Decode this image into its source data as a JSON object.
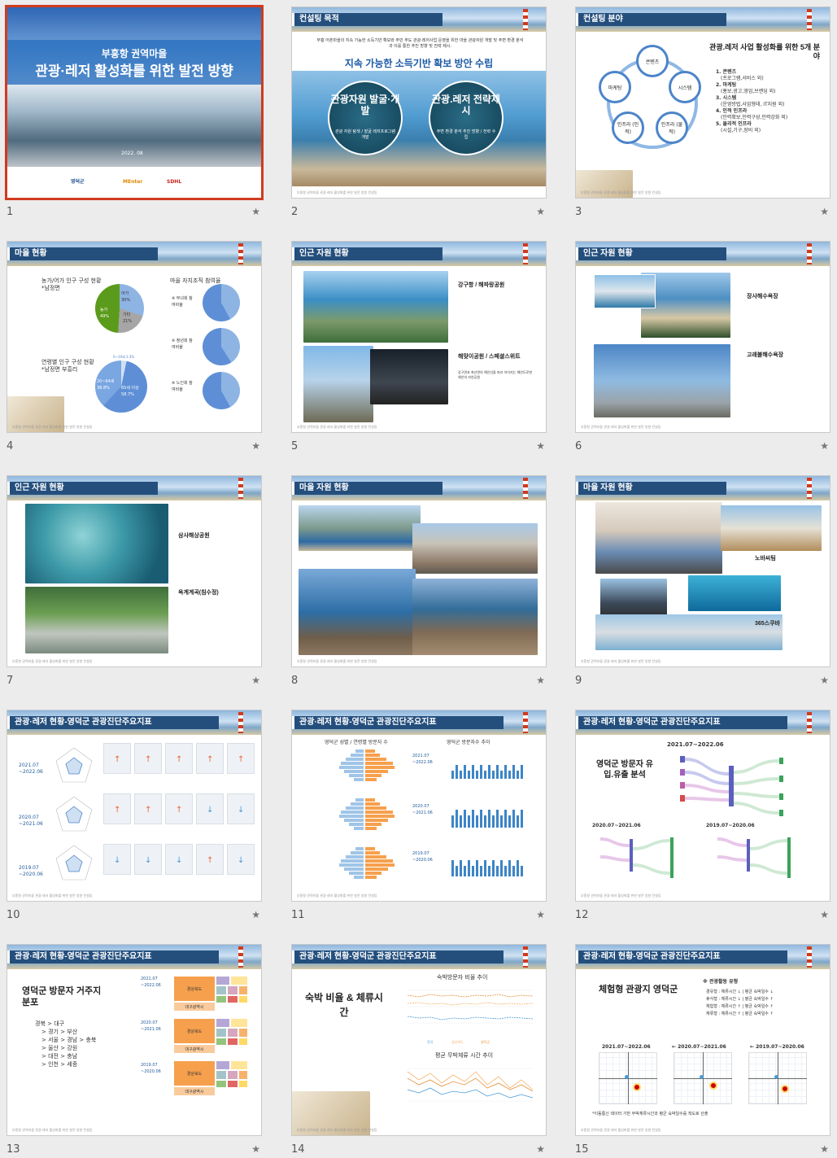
{
  "slides": [
    {
      "num": "1",
      "title_line1": "부흥항 권역마을",
      "title_line2": "관광·레저 활성화를 위한 발전 방향",
      "date": "2022. 08",
      "logo1": "영덕군",
      "logo2": "MEnter",
      "logo3": "SDHL"
    },
    {
      "num": "2",
      "header": "컨설팅 목적",
      "intro": "부흥 어촌마을의 지속 가능한 소득기반 확보와 주민 주도 관광·레저사업 운영을 위한 마을 관광자원 개발 및 주변 환경 분석과 이를 통한 추진 방향 및 전략 제시.",
      "headline": "지속 가능한 소득기반 확보 방안 수립",
      "circle1_title": "관광자원 발굴·개발",
      "circle1_sub": "관광 자원 탐색 / 발굴 레저프로그램 개발",
      "circle2_title": "관광.레저 전략제시",
      "circle2_sub": "주변 환경 분석 추진 방향 / 전략 수립"
    },
    {
      "num": "3",
      "header": "컨설팅 분야",
      "title": "관광.레저 사업 활성화를 위한 5개 분야",
      "nodes": [
        "콘텐츠",
        "시스템",
        "인프라 (물적)",
        "인프라 (인적)",
        "마케팅"
      ],
      "items": [
        {
          "t": "1. 콘텐츠",
          "d": "(프로그램,서비스 외)"
        },
        {
          "t": "2. 마케팅",
          "d": "(홍보,광고,영업,브랜딩 외)"
        },
        {
          "t": "3. 시스템",
          "d": "(운영방법,사업형태, IT지원 외)"
        },
        {
          "t": "4. 인적 인프라",
          "d": "(인력확보,인력구성,인력강화 외)"
        },
        {
          "t": "5. 물리적 인프라",
          "d": "(시설,기구,장비 외)"
        }
      ]
    },
    {
      "num": "4",
      "header": "마을 현황",
      "chart1_title": "농가/어가 인구 구성 현황",
      "chart1_sub": "*남정면",
      "chart2_title": "마을 자치조직 참여율",
      "chart3_title": "연령별 인구 구성 현황",
      "chart3_sub": "*남정면 부흥리",
      "pie1": [
        "어가 30%",
        "기타 21%",
        "농가 49%"
      ],
      "pie3": [
        "20~64세 38.8%",
        "65세 이상 58.7%",
        "0~19세 3.3%"
      ],
      "orgs": [
        "※ 부녀회 참여비율",
        "※ 청년회 참여비율",
        "※ 노인회 참여비율"
      ]
    },
    {
      "num": "5",
      "header": "인근 자원 현황",
      "label1": "강구항 / 해파랑공원",
      "label2": "해맞이공원 / 스페셜스위트",
      "label2_sub": "강구면과 축산면의 해안선을 따라 이어지는 해안도로변 해안의 자연공원"
    },
    {
      "num": "6",
      "header": "인근 자원 현황",
      "label1": "장사해수욕장",
      "label2": "고래불해수욕장"
    },
    {
      "num": "7",
      "header": "인근 자원 현황",
      "label1": "삼사해상공원",
      "label2": "옥계계곡(침수정)"
    },
    {
      "num": "8",
      "header": "마을 자원 현황"
    },
    {
      "num": "9",
      "header": "마을 자원 현황",
      "label1": "노바씨팀",
      "label2": "365스쿠바"
    },
    {
      "num": "10",
      "header": "관광·레저 현황-영덕군 관광진단주요지표",
      "periods": [
        "2021.07 ~2022.06",
        "2020.07 ~2021.06",
        "2019.07 ~2020.06"
      ]
    },
    {
      "num": "11",
      "header": "관광·레저 현황-영덕군 관광진단주요지표",
      "left_title": "영덕군 성별 / 연령별 방문자 수",
      "right_title": "영덕군 방문자수 추이",
      "periods": [
        "2021.07 ~2022.06",
        "2020.07 ~2021.06",
        "2019.07 ~2020.06"
      ]
    },
    {
      "num": "12",
      "header": "관광·레저 현황-영덕군 관광진단주요지표",
      "title": "영덕군 방문자 유입.유출 분석",
      "p1": "2021.07~2022.06",
      "p2": "2020.07~2021.06",
      "p3": "2019.07~2020.06"
    },
    {
      "num": "13",
      "header": "관광·레저 현황-영덕군 관광진단주요지표",
      "title": "영덕군 방문자 거주지 분포",
      "lines": [
        "경북 > 대구",
        "> 경기 > 부산",
        "> 서울 > 경남 > 충북",
        "> 울산 > 강원",
        "> 대전 > 충남",
        "> 인천 > 세종"
      ],
      "periods": [
        "2021.07 ~2022.06",
        "2020.07 ~2021.06",
        "2019.07 ~2020.06"
      ],
      "box1": "경상북도",
      "box2": "대구광역시"
    },
    {
      "num": "14",
      "header": "관광·레저 현황-영덕군 관광진단주요지표",
      "title": "숙박 비율 & 체류시간",
      "chart1": "숙박방문자 비율 추이",
      "chart2": "평균 무박체류 시간 추이",
      "legend": [
        "전국",
        "경상북도",
        "영덕군"
      ]
    },
    {
      "num": "15",
      "header": "관광·레저 현황-영덕군 관광진단주요지표",
      "title": "체험형 관광지 영덕군",
      "type_title": "※ 관광활동 유형",
      "types": [
        "경유형 : 체류시간 ↓ | 평균 숙박일수 ↓",
        "휴식형 : 체류시간 ↓ | 평균 숙박일수 ↑",
        "체험형 : 체류시간 ↑ | 평균 숙박일수 ↑",
        "체류형 : 체류시간 ↑ | 평균 숙박일수 ↑"
      ],
      "periods": [
        "2021.07~2022.06",
        "← 2020.07~2021.06",
        "← 2019.07~2020.06"
      ],
      "note": "*이동통신 데이터 기반 무박체류시간과 평균 숙박일수를 척도로 산출"
    }
  ],
  "footer_text": "부흥항 권역마을 관광·레저 활성화를 위한 발전 방향 컨설팅",
  "star": "★"
}
